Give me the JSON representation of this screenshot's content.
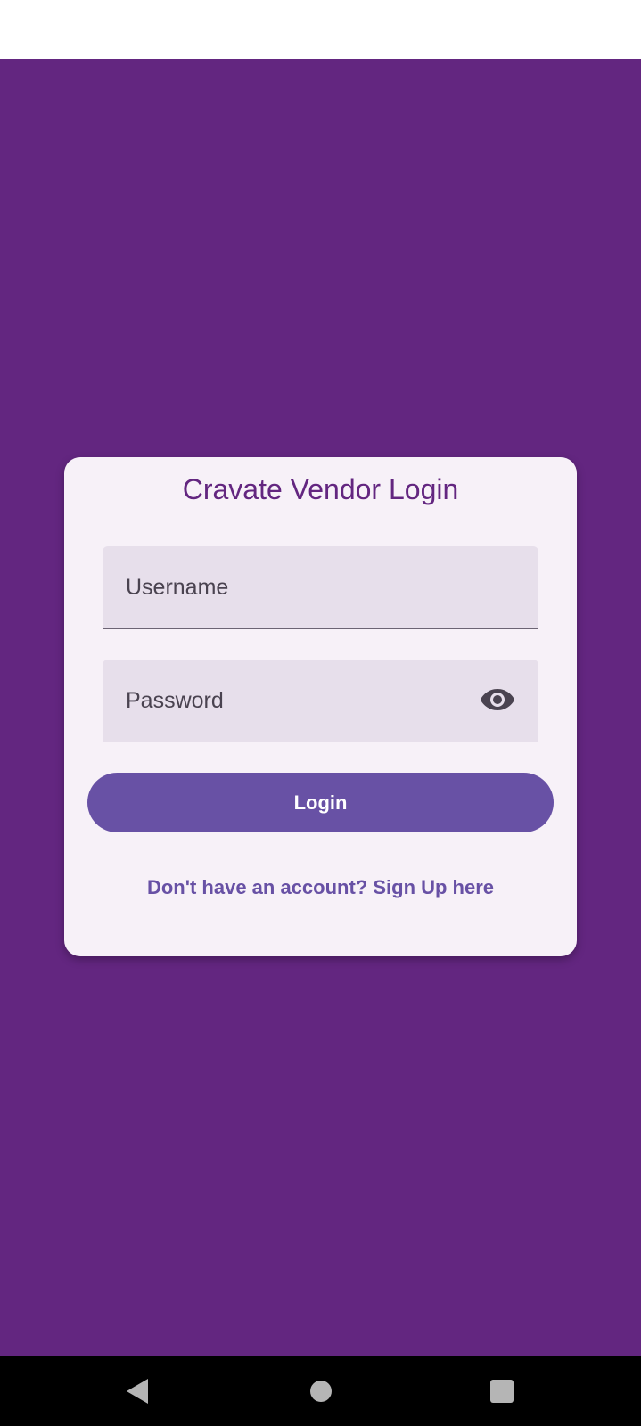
{
  "colors": {
    "background": "#632680",
    "card": "#f7f1f8",
    "title": "#632680",
    "field": "#e7dfeb",
    "button": "#6851a5",
    "link": "#6851a5"
  },
  "login_card": {
    "title": "Cravate Vendor Login",
    "username": {
      "placeholder": "Username",
      "value": ""
    },
    "password": {
      "placeholder": "Password",
      "value": "",
      "toggle_icon": "eye-icon"
    },
    "login_label": "Login",
    "signup_text": "Don't have an account? Sign Up here"
  },
  "nav_bar": {
    "buttons": [
      "back-icon",
      "home-icon",
      "recents-icon"
    ]
  }
}
